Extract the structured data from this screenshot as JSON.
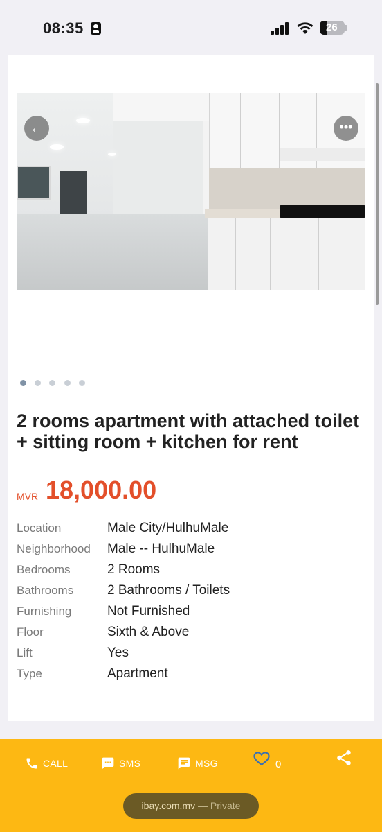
{
  "status_bar": {
    "time": "08:35",
    "battery": "26"
  },
  "listing": {
    "title": "2 rooms apartment with attached toilet + sitting room + kitchen for rent",
    "currency": "MVR",
    "price": "18,000.00",
    "image_count": 5,
    "active_image_index": 0,
    "details": [
      {
        "label": "Location",
        "value": "Male City/HulhuMale"
      },
      {
        "label": "Neighborhood",
        "value": "Male -- HulhuMale"
      },
      {
        "label": "Bedrooms",
        "value": "2 Rooms"
      },
      {
        "label": "Bathrooms",
        "value": "2 Bathrooms / Toilets"
      },
      {
        "label": "Furnishing",
        "value": "Not Furnished"
      },
      {
        "label": "Floor",
        "value": "Sixth & Above"
      },
      {
        "label": "Lift",
        "value": "Yes"
      },
      {
        "label": "Type",
        "value": "Apartment"
      }
    ]
  },
  "actions": {
    "call": "CALL",
    "sms": "SMS",
    "msg": "MSG",
    "favorites_count": "0"
  },
  "browser": {
    "domain": "ibay.com.mv",
    "mode": "— Private"
  },
  "colors": {
    "accent": "#e34f2a",
    "bar": "#fdb813"
  }
}
